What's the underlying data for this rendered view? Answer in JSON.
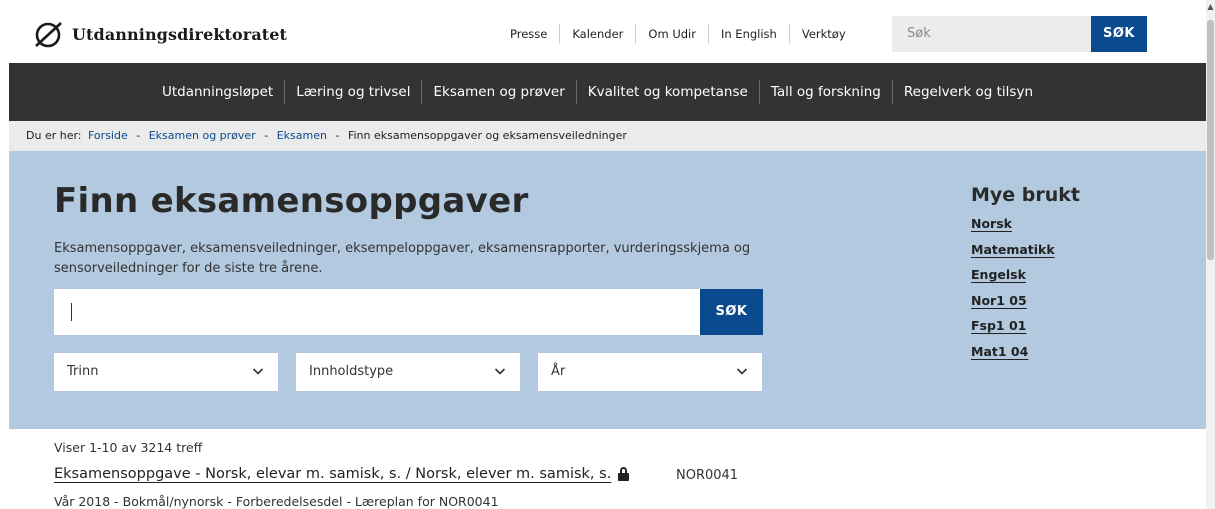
{
  "header": {
    "logo_text": "Utdanningsdirektoratet",
    "top_links": [
      "Presse",
      "Kalender",
      "Om Udir",
      "In English",
      "Verktøy"
    ],
    "search_placeholder": "Søk",
    "search_button": "SØK"
  },
  "main_nav": [
    "Utdanningsløpet",
    "Læring og trivsel",
    "Eksamen og prøver",
    "Kvalitet og kompetanse",
    "Tall og forskning",
    "Regelverk og tilsyn"
  ],
  "breadcrumb": {
    "prefix": "Du er her:",
    "links": [
      "Forside",
      "Eksamen og prøver",
      "Eksamen"
    ],
    "current": "Finn eksamensoppgaver og eksamensveiledninger"
  },
  "hero": {
    "title": "Finn eksamensoppgaver",
    "description": "Eksamensoppgaver, eksamensveiledninger, eksempeloppgaver, eksamensrapporter, vurderingsskjema og sensorveiledninger for de siste tre årene.",
    "search_value": "",
    "search_button": "SØK",
    "filters": [
      "Trinn",
      "Innholdstype",
      "År"
    ]
  },
  "popular": {
    "title": "Mye brukt",
    "links": [
      "Norsk",
      "Matematikk",
      "Engelsk",
      "Nor1 05",
      "Fsp1 01",
      "Mat1 04"
    ]
  },
  "results": {
    "count_text": "Viser 1-10 av 3214 treff",
    "items": [
      {
        "title": "Eksamensoppgave - Norsk, elevar m. samisk, s. / Norsk, elever m. samisk, s.",
        "code": "NOR0041",
        "meta": "Vår 2018  - Bokmål/nynorsk  - Forberedelsesdel  - Læreplan for NOR0041"
      }
    ]
  },
  "colors": {
    "brand_blue": "#0a4a8f",
    "nav_bg": "#333333",
    "hero_bg": "#b2c9df",
    "breadcrumb_bg": "#ebebeb"
  }
}
